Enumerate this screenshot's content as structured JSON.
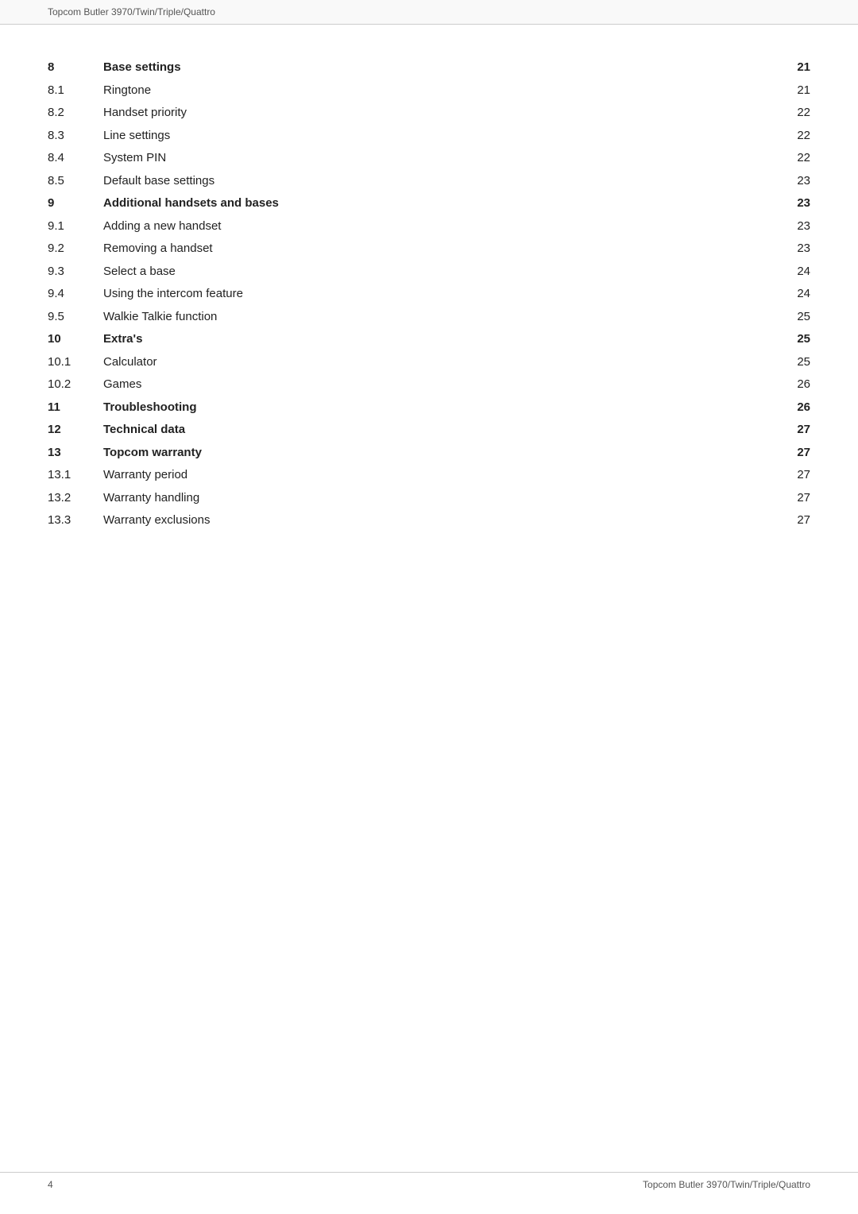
{
  "header": {
    "title": "Topcom Butler 3970/Twin/Triple/Quattro"
  },
  "footer": {
    "page_number": "4",
    "title": "Topcom Butler 3970/Twin/Triple/Quattro"
  },
  "toc": {
    "entries": [
      {
        "num": "8",
        "title": "Base settings",
        "page": "21",
        "bold": true
      },
      {
        "num": "8.1",
        "title": "Ringtone",
        "page": "21",
        "bold": false
      },
      {
        "num": "8.2",
        "title": "Handset priority",
        "page": "22",
        "bold": false
      },
      {
        "num": "8.3",
        "title": "Line settings",
        "page": "22",
        "bold": false
      },
      {
        "num": "8.4",
        "title": "System PIN",
        "page": "22",
        "bold": false
      },
      {
        "num": "8.5",
        "title": "Default base settings",
        "page": "23",
        "bold": false
      },
      {
        "num": "9",
        "title": "Additional handsets and bases",
        "page": "23",
        "bold": true
      },
      {
        "num": "9.1",
        "title": "Adding a new handset",
        "page": "23",
        "bold": false
      },
      {
        "num": "9.2",
        "title": "Removing a handset",
        "page": "23",
        "bold": false
      },
      {
        "num": "9.3",
        "title": "Select a base",
        "page": "24",
        "bold": false
      },
      {
        "num": "9.4",
        "title": "Using the intercom feature",
        "page": "24",
        "bold": false
      },
      {
        "num": "9.5",
        "title": "Walkie Talkie function",
        "page": "25",
        "bold": false
      },
      {
        "num": "10",
        "title": "Extra's",
        "page": "25",
        "bold": true
      },
      {
        "num": "10.1",
        "title": "Calculator",
        "page": "25",
        "bold": false
      },
      {
        "num": "10.2",
        "title": "Games",
        "page": "26",
        "bold": false
      },
      {
        "num": "11",
        "title": "Troubleshooting",
        "page": "26",
        "bold": true
      },
      {
        "num": "12",
        "title": "Technical data",
        "page": "27",
        "bold": true
      },
      {
        "num": "13",
        "title": "Topcom warranty",
        "page": "27",
        "bold": true
      },
      {
        "num": "13.1",
        "title": "Warranty period",
        "page": "27",
        "bold": false
      },
      {
        "num": "13.2",
        "title": "Warranty handling",
        "page": "27",
        "bold": false
      },
      {
        "num": "13.3",
        "title": "Warranty exclusions",
        "page": "27",
        "bold": false
      }
    ]
  }
}
